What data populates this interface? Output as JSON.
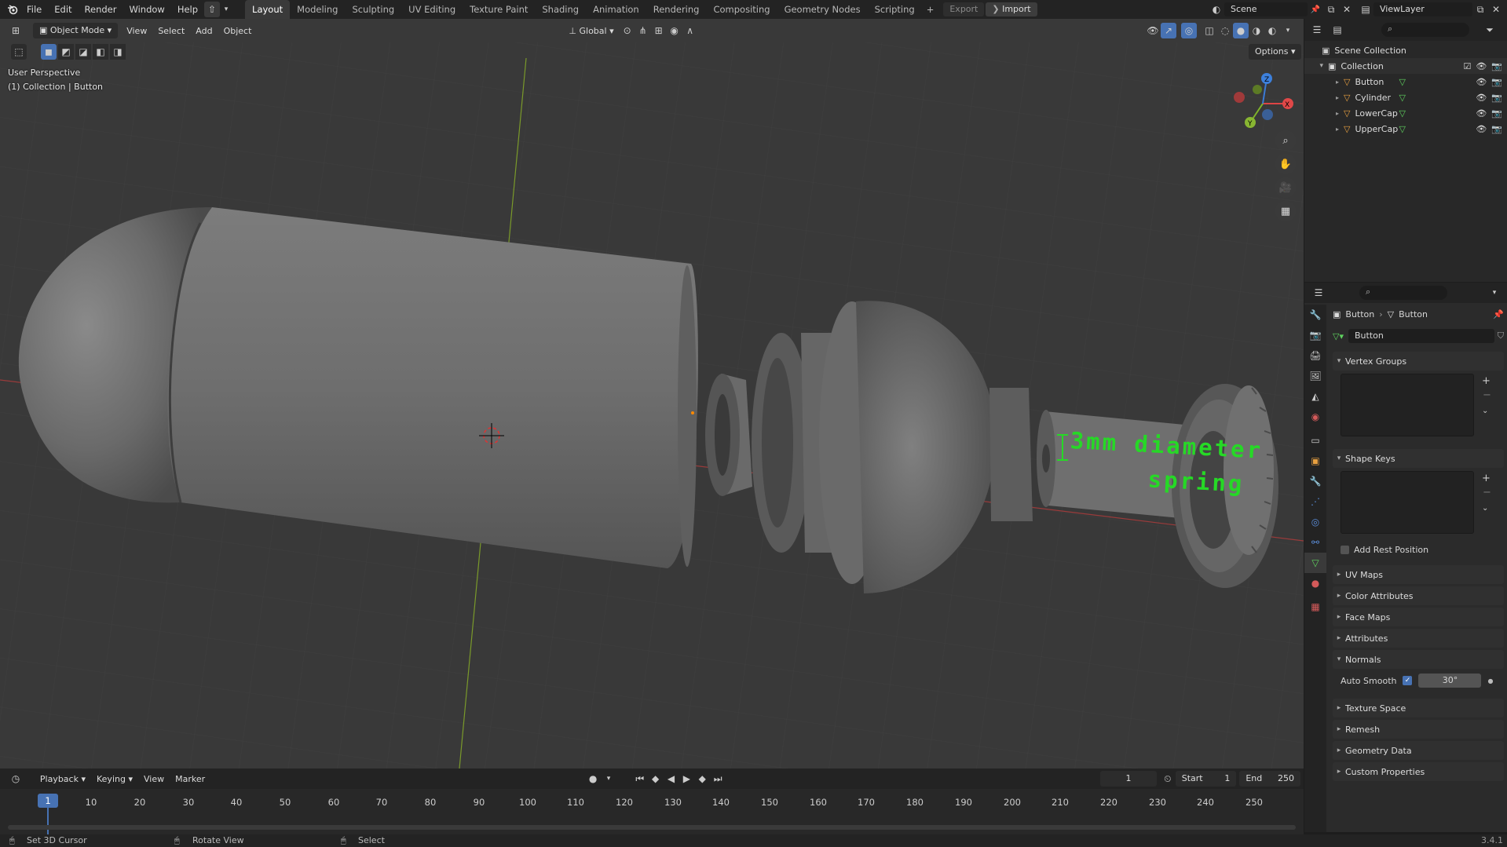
{
  "topbar": {
    "menus": [
      "File",
      "Edit",
      "Render",
      "Window",
      "Help"
    ],
    "workspaces": [
      "Layout",
      "Modeling",
      "Sculpting",
      "UV Editing",
      "Texture Paint",
      "Shading",
      "Animation",
      "Rendering",
      "Compositing",
      "Geometry Nodes",
      "Scripting"
    ],
    "active_workspace": "Layout",
    "export_label": "Export",
    "import_label": "Import",
    "scene_name": "Scene",
    "view_layer": "ViewLayer"
  },
  "viewport_header": {
    "mode": "Object Mode",
    "menus": [
      "View",
      "Select",
      "Add",
      "Object"
    ],
    "orientation": "Global",
    "options_label": "Options"
  },
  "viewport": {
    "perspective_label": "User Perspective",
    "context_label": "(1) Collection | Button",
    "annotation_line1": "3mm diameter",
    "annotation_line2": "spring",
    "annotation_color": "#26d926",
    "gizmo_axes": [
      "X",
      "Y",
      "Z"
    ]
  },
  "outliner": {
    "root": "Scene Collection",
    "collection": "Collection",
    "objects": [
      "Button",
      "Cylinder",
      "LowerCap",
      "UpperCap"
    ]
  },
  "properties": {
    "breadcrumb_object": "Button",
    "breadcrumb_data": "Button",
    "mesh_name": "Button",
    "panels": {
      "vertex_groups": "Vertex Groups",
      "shape_keys": "Shape Keys",
      "add_rest_position": "Add Rest Position",
      "uv_maps": "UV Maps",
      "color_attributes": "Color Attributes",
      "face_maps": "Face Maps",
      "attributes": "Attributes",
      "normals": "Normals",
      "auto_smooth": "Auto Smooth",
      "auto_smooth_angle": "30°",
      "texture_space": "Texture Space",
      "remesh": "Remesh",
      "geometry_data": "Geometry Data",
      "custom_properties": "Custom Properties"
    }
  },
  "timeline": {
    "menus": [
      "Playback",
      "Keying",
      "View",
      "Marker"
    ],
    "current_frame": "1",
    "start_label": "Start",
    "start_value": "1",
    "end_label": "End",
    "end_value": "250",
    "ticks": [
      "10",
      "20",
      "30",
      "40",
      "50",
      "60",
      "70",
      "80",
      "90",
      "100",
      "110",
      "120",
      "130",
      "140",
      "150",
      "160",
      "170",
      "180",
      "190",
      "200",
      "210",
      "220",
      "230",
      "240",
      "250"
    ]
  },
  "statusbar": {
    "hint1": "Set 3D Cursor",
    "hint2": "Rotate View",
    "hint3": "Select",
    "version": "3.4.1"
  }
}
